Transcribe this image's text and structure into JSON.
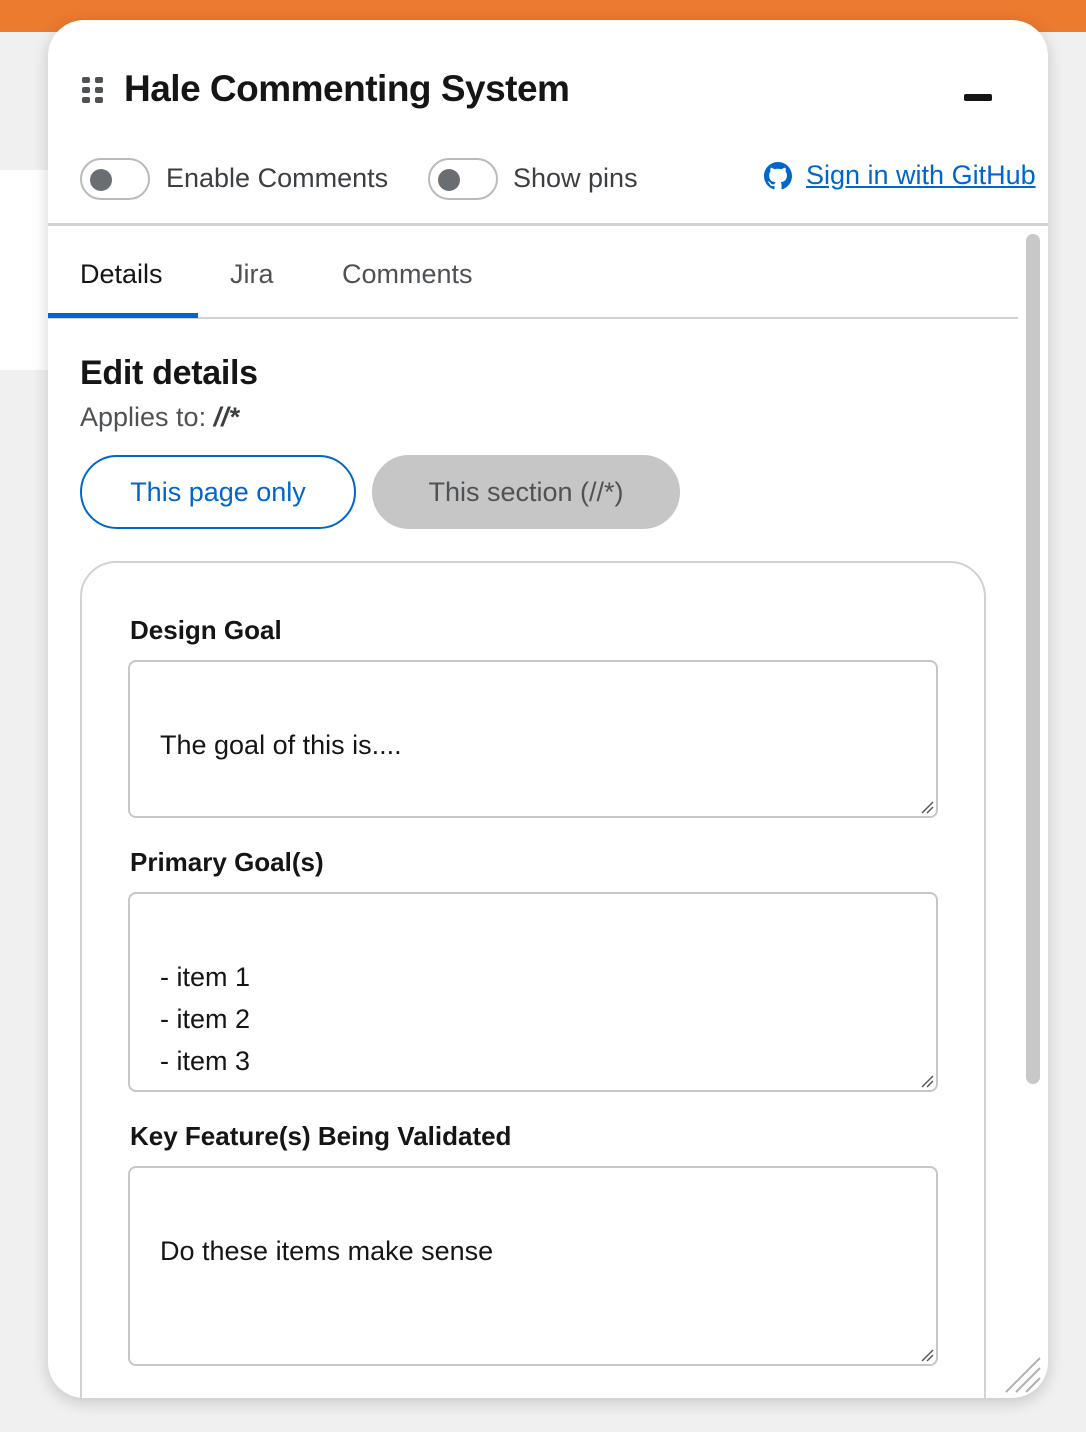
{
  "header": {
    "title": "Hale Commenting System",
    "enable_comments_label": "Enable Comments",
    "show_pins_label": "Show pins",
    "github_link_label": "Sign in with GitHub"
  },
  "toggles": {
    "enable_comments_on": false,
    "show_pins_on": false
  },
  "tabs": [
    {
      "label": "Details",
      "active": true
    },
    {
      "label": "Jira",
      "active": false
    },
    {
      "label": "Comments",
      "active": false
    }
  ],
  "details": {
    "title": "Edit details",
    "applies_label": "Applies to:",
    "applies_value": "//*",
    "scope_page_label": "This page only",
    "scope_section_label": "This section (//*)"
  },
  "fields": [
    {
      "label": "Design Goal",
      "value": "The goal of this is...."
    },
    {
      "label": "Primary Goal(s)",
      "value": "- item 1\n- item 2\n- item 3"
    },
    {
      "label": "Key Feature(s) Being Validated",
      "value": "Do these items make sense"
    }
  ],
  "icons": {
    "drag": "drag-handle-icon",
    "minimize": "minimize-icon",
    "github": "github-icon",
    "resize": "resize-grip-icon"
  },
  "colors": {
    "accent": "#0066cc",
    "top_bar": "#ec7a2f",
    "selected_scope_bg": "#c6c6c6"
  }
}
